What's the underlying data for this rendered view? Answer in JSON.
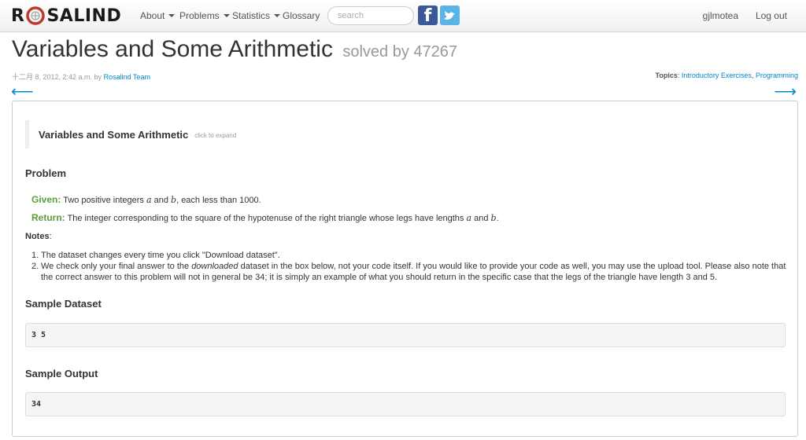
{
  "nav": {
    "logo_left": "R",
    "logo_right": "SALIND",
    "items": [
      {
        "label": "About"
      },
      {
        "label": "Problems"
      },
      {
        "label": "Statistics"
      },
      {
        "label": "Glossary"
      }
    ],
    "search_placeholder": "search",
    "facebook_icon": "facebook-icon",
    "twitter_icon": "twitter-icon",
    "user": "gjlmotea",
    "logout": "Log out"
  },
  "page": {
    "title": "Variables and Some Arithmetic",
    "solved": "solved by 47267",
    "date": "十二月 8, 2012, 2:42 a.m. by",
    "author": "Rosalind Team",
    "topics_label": "Topics",
    "topics_sep": ": ",
    "topic1": "Introductory Exercises",
    "topic_comma": ", ",
    "topic2": "Programming",
    "prev_arrow": "⟵",
    "next_arrow": "⟶"
  },
  "problem": {
    "summary_title": "Variables and Some Arithmetic",
    "expand": "click to expand",
    "heading": "Problem",
    "given_label": "Given:",
    "given_text_1": "Two positive integers",
    "var_a": "a",
    "and": "and",
    "var_b": "b",
    "given_text_2": ", each less than 1000.",
    "return_label": "Return:",
    "return_text_1": "The integer corresponding to the square of the hypotenuse of the right triangle whose legs have lengths",
    "return_end": ".",
    "notes_label": "Notes",
    "notes_colon": ":",
    "note1": "The dataset changes every time you click \"Download dataset\".",
    "note2_a": "We check only your final answer to the",
    "note2_em": "downloaded",
    "note2_b": "dataset in the box below, not your code itself. If you would like to provide your code as well, you may use the upload tool. Please also note that the correct answer to this problem will not in general be 34; it is simply an example of what you should return in the specific case that the legs of the triangle have length 3 and 5.",
    "sample_dataset_heading": "Sample Dataset",
    "sample_dataset": "3 5",
    "sample_output_heading": "Sample Output",
    "sample_output": "34"
  },
  "colors": {
    "link": "#0088cc",
    "given_green": "#5a9e3b",
    "logo_red": "#c0392b"
  }
}
